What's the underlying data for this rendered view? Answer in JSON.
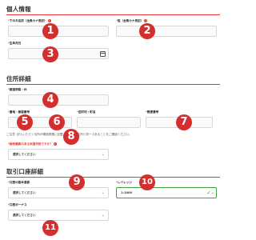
{
  "personal": {
    "title": "個人情報",
    "lastname_kana_label": "下のお名前（全角カナ表記）",
    "firstname_kana_label": "姓（全角カナ表記）",
    "birthdate_label": "生年月日"
  },
  "address": {
    "title": "住所詳細",
    "prefecture_label": "都道府県・州",
    "block_label": "番地・部屋番号",
    "city_label": "区町村・町名",
    "postal_label": "郵便番号",
    "note": "ご注意: 記入いただく住所が確認書類に記載されている住所と同一であることをご確認ください。",
    "foreign_tax_label": "納税義務のある米国市民ですか？",
    "foreign_tax_value": "選択してください"
  },
  "trading": {
    "title": "取引口座詳細",
    "base_currency_label": "口座の基本通貨",
    "base_currency_value": "選択してください",
    "leverage_label": "レバレッジ",
    "leverage_value": "1:1000",
    "bonus_label": "口座ボーナス",
    "bonus_value": "選択してください"
  },
  "markers": [
    "1",
    "2",
    "3",
    "4",
    "5",
    "6",
    "7",
    "8",
    "9",
    "10",
    "11"
  ],
  "colors": {
    "accent": "#e53935",
    "marker": "#d32f2f",
    "valid": "#43a047"
  }
}
